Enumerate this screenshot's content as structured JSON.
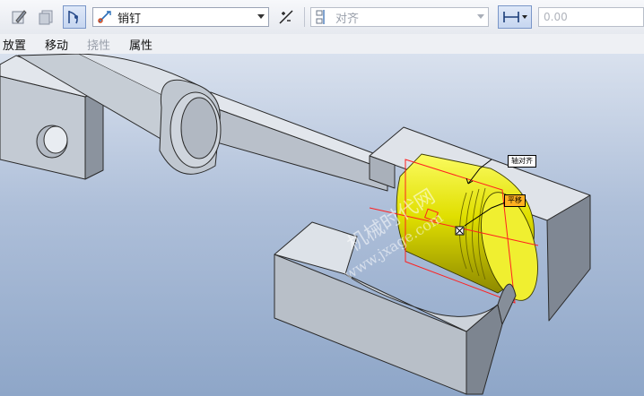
{
  "toolbar": {
    "constraint_type": "销钉",
    "alignment": "对齐",
    "offset_value": "0.00"
  },
  "menu": {
    "placement": "放置",
    "move": "移动",
    "flexibility": "挠性",
    "properties": "属性"
  },
  "annotations": {
    "label_top": "轴对齐",
    "label_right": "平移"
  },
  "watermark": {
    "line1": "机械时代网",
    "line2": "www.jxage.com"
  },
  "colors": {
    "part_gray": "#c4cbd4",
    "piston_yellow": "#e6e400",
    "datum_red": "#ff2020",
    "label_bg": "#ffb020"
  }
}
